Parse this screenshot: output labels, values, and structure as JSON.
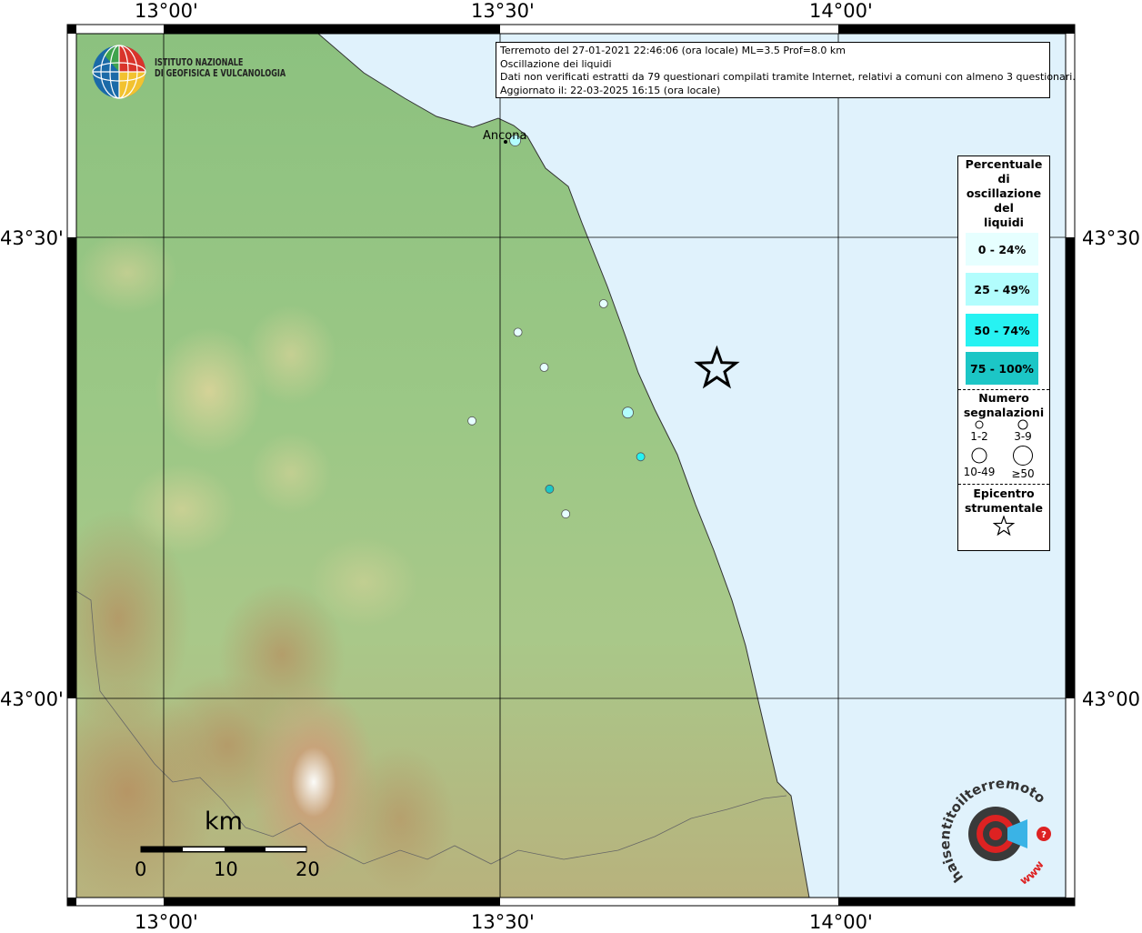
{
  "logo": {
    "line1": "ISTITUTO NAZIONALE",
    "line2": "DI GEOFISICA E VULCANOLOGIA"
  },
  "info": {
    "line1": "Terremoto del 27-01-2021 22:46:06 (ora locale) ML=3.5 Prof=8.0 km",
    "line2": "Oscillazione dei liquidi",
    "line3": "Dati non verificati estratti da 79 questionari compilati tramite Internet, relativi a comuni con almeno 3 questionari.",
    "line4": "Aggiornato il: 22-03-2025 16:15 (ora locale)"
  },
  "axes": {
    "lon_ticks": [
      "13°00'",
      "13°30'",
      "14°00'"
    ],
    "lat_ticks": [
      "43°30'",
      "43°00'"
    ]
  },
  "city": {
    "name": "Ancona"
  },
  "legend": {
    "title": [
      "Percentuale",
      "di",
      "oscillazione",
      "del",
      "liquidi"
    ],
    "classes": [
      {
        "label": "0 - 24%",
        "color": "#e6ffff"
      },
      {
        "label": "25 - 49%",
        "color": "#b2fdfd"
      },
      {
        "label": "50 - 74%",
        "color": "#27f2f2"
      },
      {
        "label": "75 - 100%",
        "color": "#1cc6c6"
      }
    ],
    "count_title": [
      "Numero",
      "segnalazioni"
    ],
    "count_classes": [
      "1-2",
      "3-9",
      "10-49",
      "≥50"
    ],
    "epi_title": [
      "Epicentro",
      "strumentale"
    ]
  },
  "scale": {
    "unit": "km",
    "labels": [
      "0",
      "10",
      "20"
    ]
  },
  "observations": [
    {
      "lon": 13.521,
      "lat": 43.605,
      "pct_class": 1,
      "size": "3-9"
    },
    {
      "lon": 13.652,
      "lat": 43.428,
      "pct_class": 0,
      "size": "1-2"
    },
    {
      "lon": 13.525,
      "lat": 43.397,
      "pct_class": 0,
      "size": "1-2"
    },
    {
      "lon": 13.564,
      "lat": 43.359,
      "pct_class": 0,
      "size": "1-2"
    },
    {
      "lon": 13.457,
      "lat": 43.301,
      "pct_class": 0,
      "size": "1-2"
    },
    {
      "lon": 13.688,
      "lat": 43.31,
      "pct_class": 1,
      "size": "3-9"
    },
    {
      "lon": 13.707,
      "lat": 43.262,
      "pct_class": 2,
      "size": "1-2"
    },
    {
      "lon": 13.572,
      "lat": 43.227,
      "pct_class": 3,
      "size": "1-2"
    },
    {
      "lon": 13.596,
      "lat": 43.2,
      "pct_class": 0,
      "size": "1-2"
    }
  ],
  "epicenter": {
    "lon": 13.82,
    "lat": 43.357
  },
  "sponsor": {
    "text1": "haisentitoilterremoto.it",
    "text2": "www."
  }
}
